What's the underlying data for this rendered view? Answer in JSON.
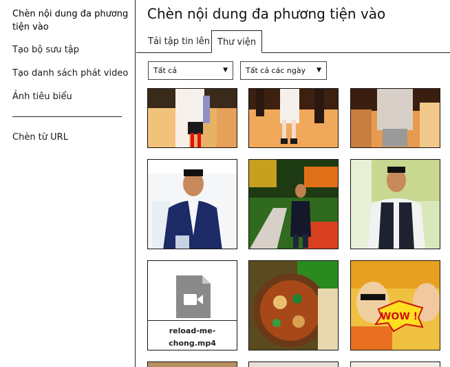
{
  "sidebar": {
    "items": [
      {
        "label": "Chèn nội dung đa phương tiện vào"
      },
      {
        "label": "Tạo bộ sưu tập"
      },
      {
        "label": "Tạo danh sách phát video"
      },
      {
        "label": "Ảnh tiêu biểu"
      },
      {
        "label": "Chèn từ URL"
      }
    ]
  },
  "main": {
    "title": "Chèn nội dung đa phương tiện vào",
    "tabs": [
      {
        "label": "Tải tập tin lên"
      },
      {
        "label": "Thư viện"
      }
    ],
    "filters": {
      "type": "Tất cả",
      "date": "Tất cả các ngày"
    },
    "files": {
      "video_name": "reload-me-chong.mp4"
    }
  }
}
